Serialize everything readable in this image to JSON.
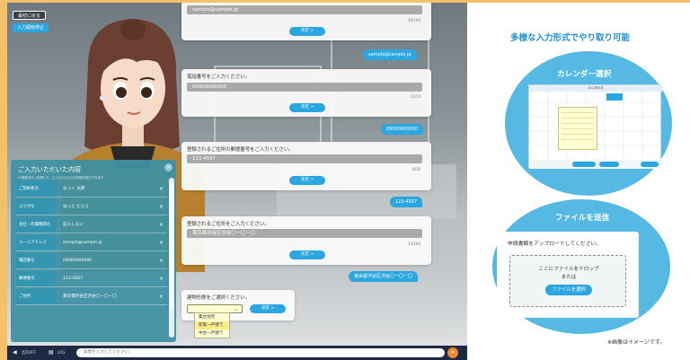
{
  "app": {
    "back_button": "最初に戻る",
    "stop_button": "入力開始停止",
    "cards": [
      {
        "input_value": "sample@sample.jp",
        "counter": "16/100",
        "ok_label": "決定 >"
      },
      {
        "question": "電話番号をご入力ください。",
        "input_value": "09000000000",
        "counter": "11/13",
        "ok_label": "決定 >"
      },
      {
        "question": "登録されるご住所の郵便番号をご入力ください。",
        "input_value": "123-4567",
        "counter": "8/10",
        "ok_label": "決定 >"
      },
      {
        "question": "登録されるご住所をご入力ください。",
        "input_value": "東京都渋谷区渋谷〇ー〇ー〇",
        "counter": "13/100",
        "ok_label": "決定 >"
      },
      {
        "question": "建物形態をご選択ください。",
        "ok_label": "決定 >"
      }
    ],
    "bubbles": {
      "email": "sample@sample.jp",
      "phone": "09000000000",
      "zip": "123-4567",
      "address": "東京都渋谷区渋谷〇ー〇ー〇"
    },
    "dropdown_options": [
      "集合住宅",
      "新築一戸建て",
      "中古一戸建て"
    ],
    "summary": {
      "title": "ご入力いただいた内容",
      "subtitle": "※ 削除ボタンを押して、ご入力いただいた内容を修正できます",
      "rows": [
        {
          "label": "ご契約者名",
          "value": "みっく 太郎"
        },
        {
          "label": "ふりがな",
          "value": "ねっと たろう"
        },
        {
          "label": "会社・所属機関名",
          "value": "記入しない"
        },
        {
          "label": "メールアドレス",
          "value": "sample@sample.jp"
        },
        {
          "label": "電話番号",
          "value": "09000000000"
        },
        {
          "label": "郵便番号",
          "value": "123-4567"
        },
        {
          "label": "ご住所",
          "value": "東京都渋谷区渋谷〇ー〇ー〇"
        }
      ]
    },
    "bottom": {
      "voice_label": "音声OFF",
      "log_label": "LOG",
      "input_placeholder": "質問を入力してください。"
    }
  },
  "right": {
    "headline": "多様な入力形式でやり取り可能",
    "calendar_title": "カレンダー選択",
    "calendar_month": "2022年4月",
    "file_title": "ファイルを送信",
    "file_lead": "申請書類をアップロードしてください。",
    "drop_line1": "ここにファイルをドロップ",
    "drop_line2": "または",
    "select_button": "ファイルを選択",
    "note": "※画像はイメージです。"
  },
  "colors": {
    "accent": "#2aa6e0",
    "frame": "#f5c06a",
    "panel": "#3f91a4",
    "circle": "#55b9e3",
    "headline": "#1f8fcf"
  },
  "icons": [
    "speaker-icon",
    "log-icon",
    "send-icon",
    "close-icon",
    "chevron-down-icon",
    "delete-icon"
  ]
}
